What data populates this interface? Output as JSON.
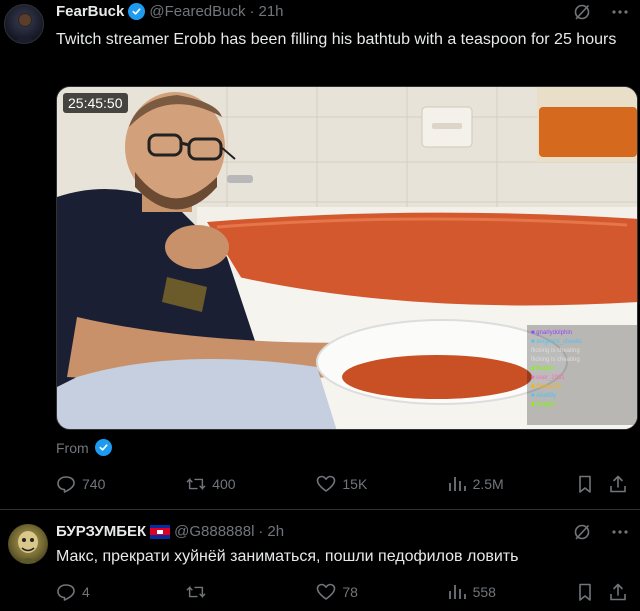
{
  "tweet1": {
    "author_name": "FearBuck",
    "handle": "@FearedBuck",
    "separator": "·",
    "time": "21h",
    "text": "Twitch streamer Erobb has been filling his bathtub with a teaspoon for 25 hours",
    "media": {
      "timer": "25:45:50"
    },
    "from_label": "From",
    "actions": {
      "replies": "740",
      "reposts": "400",
      "likes": "15K",
      "views": "2.5M"
    }
  },
  "tweet2": {
    "author_name": "БУРЗУМБЕК",
    "handle": "@G888888l",
    "separator": "·",
    "time": "2h",
    "text": "Макс, прекрати хуйнёй заниматься, пошли педофилов ловить",
    "actions": {
      "replies": "4",
      "reposts": "",
      "likes": "78",
      "views": "558"
    }
  },
  "colors": {
    "background": "#000000",
    "text_primary": "#e7e9ea",
    "text_secondary": "#71767b",
    "verified_blue": "#1d9bf0",
    "divider": "#2f3336"
  },
  "icons": [
    "grok-icon",
    "more-icon",
    "reply-icon",
    "repost-icon",
    "like-icon",
    "views-icon",
    "bookmark-icon",
    "share-icon",
    "verified-badge-icon",
    "cambodia-flag-icon"
  ]
}
